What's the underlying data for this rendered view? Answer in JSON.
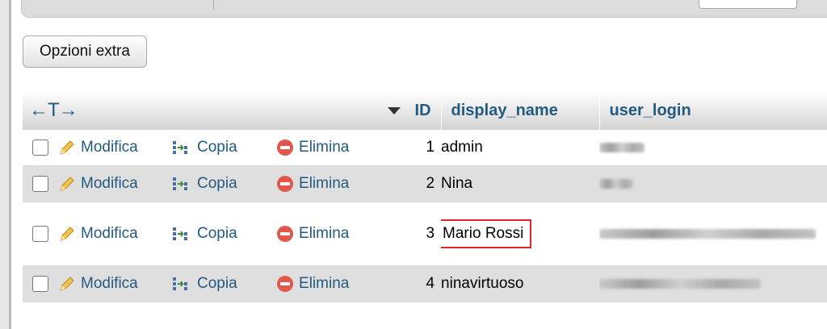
{
  "toolbar": {
    "extra_options_label": "Opzioni extra"
  },
  "table": {
    "nav_arrows": "←T→",
    "columns": {
      "id": "ID",
      "display_name": "display_name",
      "user_login": "user_login"
    },
    "actions": {
      "edit": "Modifica",
      "copy": "Copia",
      "delete": "Elimina"
    },
    "rows": [
      {
        "id": "1",
        "display_name": "admin",
        "user_login": ""
      },
      {
        "id": "2",
        "display_name": "Nina",
        "user_login": ""
      },
      {
        "id": "3",
        "display_name": "Mario Rossi",
        "user_login": ""
      },
      {
        "id": "4",
        "display_name": "ninavirtuoso",
        "user_login": ""
      }
    ]
  },
  "colors": {
    "link": "#235a81",
    "highlight_border": "#e3252b",
    "row_alt": "#dfdfdf"
  },
  "icons": {
    "edit": "pencil-icon",
    "copy": "copy-icon",
    "delete": "delete-icon",
    "sort": "sort-desc-icon"
  }
}
